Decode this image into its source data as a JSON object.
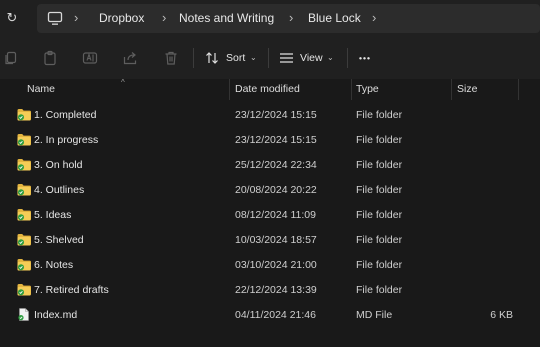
{
  "address": {
    "breadcrumbs": [
      "Dropbox",
      "Notes and Writing",
      "Blue Lock"
    ]
  },
  "toolbar": {
    "sort_label": "Sort",
    "view_label": "View",
    "more_label": "•••"
  },
  "columns": {
    "name": "Name",
    "date": "Date modified",
    "type": "Type",
    "size": "Size"
  },
  "files": [
    {
      "name": "1. Completed",
      "date": "23/12/2024 15:15",
      "type": "File folder",
      "size": ""
    },
    {
      "name": "2. In progress",
      "date": "23/12/2024 15:15",
      "type": "File folder",
      "size": ""
    },
    {
      "name": "3. On hold",
      "date": "25/12/2024 22:34",
      "type": "File folder",
      "size": ""
    },
    {
      "name": "4. Outlines",
      "date": "20/08/2024 20:22",
      "type": "File folder",
      "size": ""
    },
    {
      "name": "5. Ideas",
      "date": "08/12/2024 11:09",
      "type": "File folder",
      "size": ""
    },
    {
      "name": "5. Shelved",
      "date": "10/03/2024 18:57",
      "type": "File folder",
      "size": ""
    },
    {
      "name": "6. Notes",
      "date": "03/10/2024 21:00",
      "type": "File folder",
      "size": ""
    },
    {
      "name": "7. Retired drafts",
      "date": "22/12/2024 13:39",
      "type": "File folder",
      "size": ""
    },
    {
      "name": "Index.md",
      "date": "04/11/2024 21:46",
      "type": "MD File",
      "size": "6 KB"
    }
  ]
}
